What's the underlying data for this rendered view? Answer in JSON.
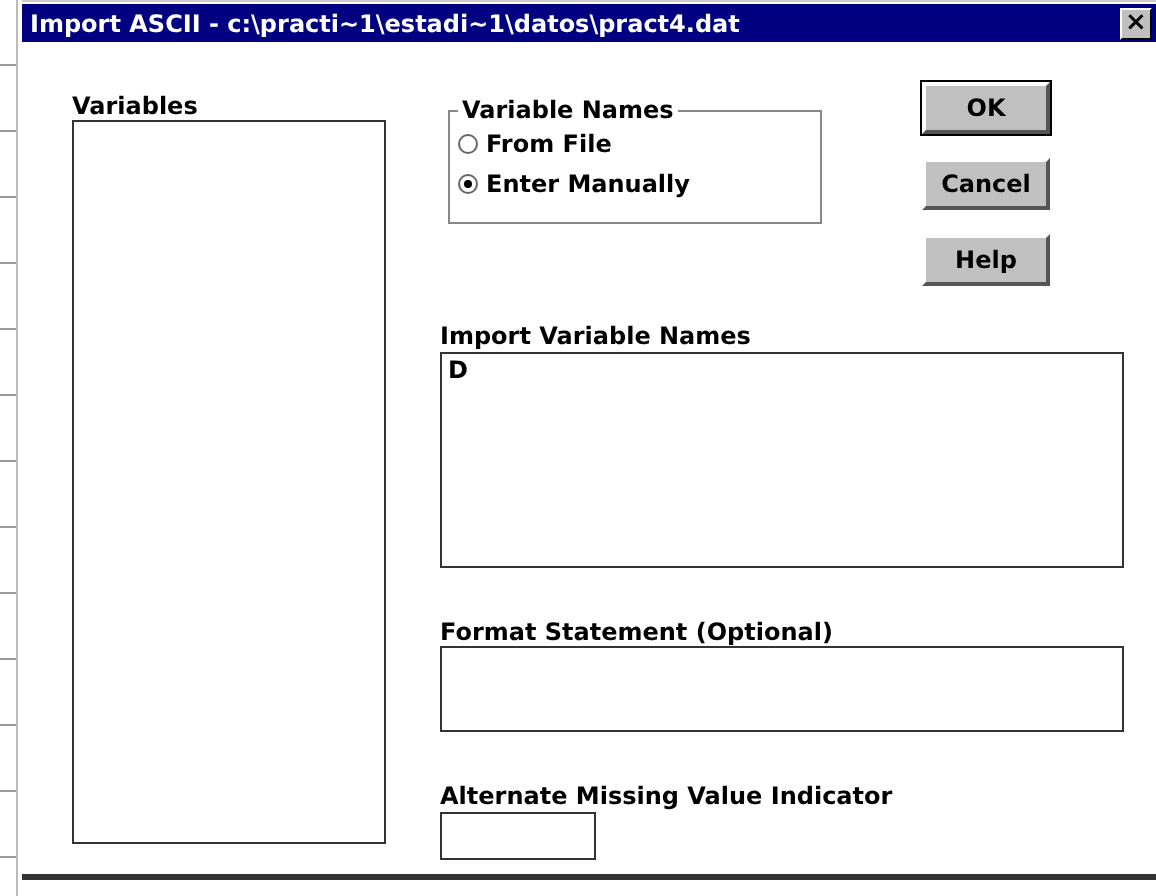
{
  "window": {
    "title": "Import ASCII - c:\\practi~1\\estadi~1\\datos\\pract4.dat",
    "close": "×"
  },
  "variables": {
    "label": "Variables"
  },
  "variable_names": {
    "label": "Variable Names",
    "options": [
      {
        "label": "From File",
        "selected": false
      },
      {
        "label": "Enter Manually",
        "selected": true
      }
    ]
  },
  "buttons": [
    "OK",
    "Cancel",
    "Help"
  ],
  "import_names": {
    "label": "Import Variable Names",
    "value": "D"
  },
  "format": {
    "label": "Format Statement (Optional)"
  },
  "missing": {
    "label": "Alternate Missing Value Indicator"
  }
}
